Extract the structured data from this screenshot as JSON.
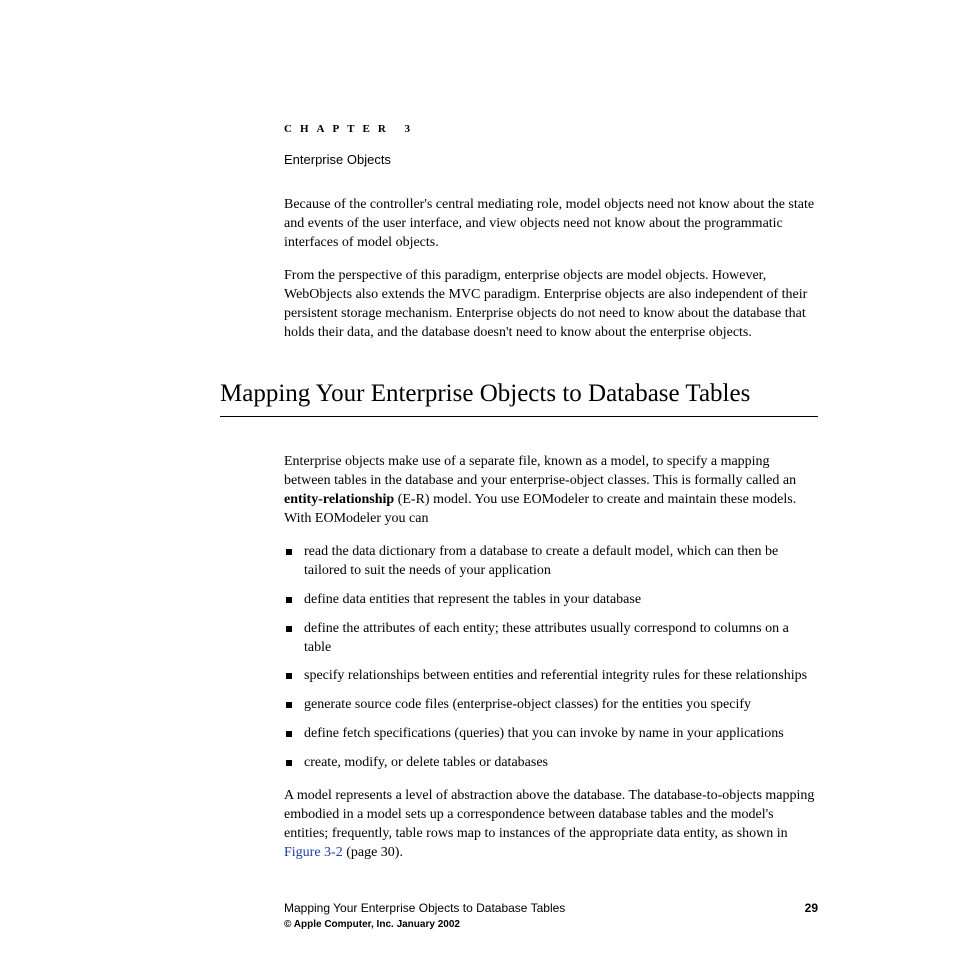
{
  "chapter": {
    "label": "CHAPTER 3",
    "title": "Enterprise Objects"
  },
  "paragraphs": {
    "p1": "Because of the controller's central mediating role, model objects need not know about the state and events of the user interface, and view objects need not know about the programmatic interfaces of model objects.",
    "p2": "From the perspective of this paradigm, enterprise objects are model objects. However, WebObjects also extends the MVC paradigm. Enterprise objects are also independent of their persistent storage mechanism. Enterprise objects do not need to know about the database that holds their data, and the database doesn't need to know about the enterprise objects."
  },
  "section": {
    "heading": "Mapping Your Enterprise Objects to Database Tables",
    "intro_before_bold": "Enterprise objects make use of a separate file, known as a model, to specify a mapping between tables in the database and your enterprise-object classes. This is formally called an ",
    "intro_bold": "entity-relationship",
    "intro_after_bold": " (E-R) model. You use EOModeler to create and maintain these models. With EOModeler you can",
    "bullets": [
      "read the data dictionary from a database to create a default model, which can then be tailored to suit the needs of your application",
      "define data entities that represent the tables in your database",
      "define the attributes of each entity; these attributes usually correspond to columns on a table",
      "specify relationships between entities and referential integrity rules for these relationships",
      "generate source code files (enterprise-object classes) for the entities you specify",
      "define fetch specifications (queries) that you can invoke by name in your applications",
      "create, modify, or delete tables or databases"
    ],
    "closing_before_link": "A model represents a level of abstraction above the database. The database-to-objects mapping embodied in a model sets up a correspondence between database tables and the model's entities; frequently, table rows map to instances of the appropriate data entity, as shown in ",
    "closing_link": "Figure 3-2",
    "closing_after_link": " (page 30)."
  },
  "footer": {
    "title": "Mapping Your Enterprise Objects to Database Tables",
    "page": "29",
    "copyright": "© Apple Computer, Inc. January 2002"
  }
}
